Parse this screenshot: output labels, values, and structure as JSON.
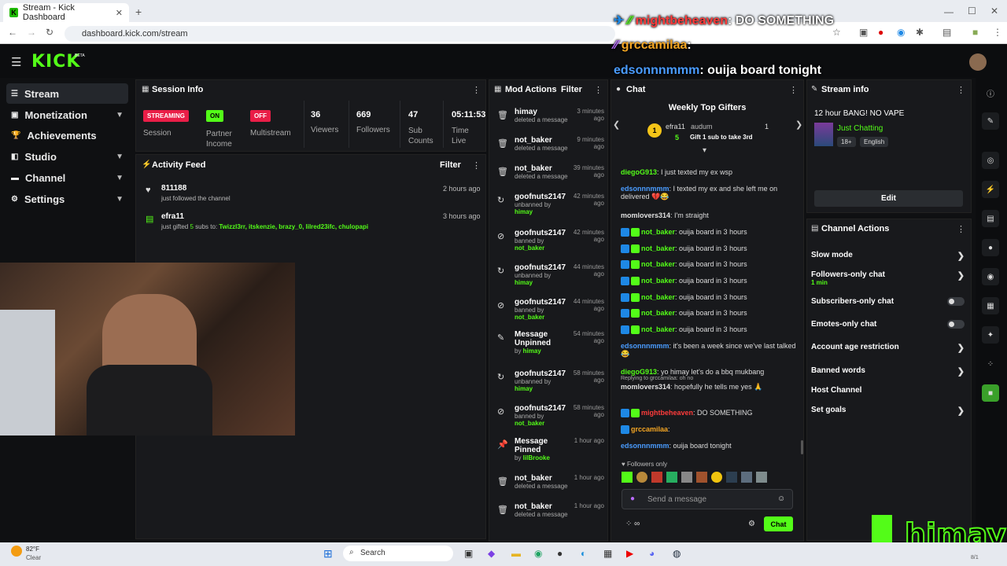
{
  "browser": {
    "tab_title": "Stream - Kick Dashboard",
    "url": "dashboard.kick.com/stream",
    "new_tab": "+"
  },
  "logo": {
    "text": "KICK",
    "beta": "BETA"
  },
  "sidebar": {
    "items": [
      {
        "label": "Stream",
        "icon": "stream-icon"
      },
      {
        "label": "Monetization",
        "icon": "monetization-icon"
      },
      {
        "label": "Achievements",
        "icon": "trophy-icon"
      },
      {
        "label": "Studio",
        "icon": "studio-icon"
      },
      {
        "label": "Channel",
        "icon": "channel-icon"
      },
      {
        "label": "Settings",
        "icon": "gear-icon"
      }
    ]
  },
  "session_info": {
    "title": "Session Info",
    "stats": [
      {
        "badge": "STREAMING",
        "label": "Session"
      },
      {
        "badge": "ON",
        "label": "Partner Income"
      },
      {
        "badge": "OFF",
        "label": "Multistream"
      },
      {
        "value": "36",
        "label": "Viewers"
      },
      {
        "value": "669",
        "label": "Followers"
      },
      {
        "value": "47",
        "label": "Sub Counts"
      },
      {
        "value": "05:11:53",
        "label": "Time Live"
      }
    ]
  },
  "activity_feed": {
    "title": "Activity Feed",
    "filter": "Filter",
    "items": [
      {
        "user": "811188",
        "text": "just followed the channel",
        "time": "2 hours ago"
      },
      {
        "user": "efra11",
        "text_pre": "just gifted ",
        "count": "5",
        "text_mid": " subs to: ",
        "recipients": "Twizzl3rr, itskenzie, brazy_0, lilred23ifc, chulopapi",
        "time": "3 hours ago"
      }
    ]
  },
  "mod_actions": {
    "title": "Mod Actions",
    "filter": "Filter",
    "items": [
      {
        "name": "himay",
        "action": "deleted a message",
        "by": "",
        "time": "3 minutes ago"
      },
      {
        "name": "not_baker",
        "action": "deleted a message",
        "by": "",
        "time": "9 minutes ago"
      },
      {
        "name": "not_baker",
        "action": "deleted a message",
        "by": "",
        "time": "39 minutes ago"
      },
      {
        "name": "goofnuts2147",
        "action": "unbanned by ",
        "by": "himay",
        "time": "42 minutes ago"
      },
      {
        "name": "goofnuts2147",
        "action": "banned by ",
        "by": "not_baker",
        "time": "42 minutes ago"
      },
      {
        "name": "goofnuts2147",
        "action": "unbanned by ",
        "by": "himay",
        "time": "44 minutes ago"
      },
      {
        "name": "goofnuts2147",
        "action": "banned by ",
        "by": "not_baker",
        "time": "44 minutes ago"
      },
      {
        "name": "Message Unpinned",
        "action": "by ",
        "by": "himay",
        "time": "54 minutes ago"
      },
      {
        "name": "goofnuts2147",
        "action": "unbanned by ",
        "by": "himay",
        "time": "58 minutes ago"
      },
      {
        "name": "goofnuts2147",
        "action": "banned by ",
        "by": "not_baker",
        "time": "58 minutes ago"
      },
      {
        "name": "Message Pinned",
        "action": "by ",
        "by": "lilBrooke",
        "time": "1 hour ago"
      },
      {
        "name": "not_baker",
        "action": "deleted a message",
        "by": "",
        "time": "1 hour ago"
      },
      {
        "name": "not_baker",
        "action": "deleted a message",
        "by": "",
        "time": "1 hour ago"
      }
    ]
  },
  "chat": {
    "title": "Chat",
    "top_gifters_title": "Weekly Top Gifters",
    "gifter1": {
      "rank": "1",
      "name": "efra11",
      "count": "5"
    },
    "gifter2": {
      "name": "audum",
      "count": "1",
      "cta": "Gift 1 sub to take 3rd"
    },
    "messages": [
      {
        "user": "diegoG913",
        "color": "#53fc18",
        "text": ": I just texted my ex wsp",
        "badges": 0
      },
      {
        "user": "edsonnnmmm",
        "color": "#4a9cff",
        "text": ": I texted my ex and she left me on delivered 💔😂",
        "badges": 0
      },
      {
        "user": "momlovers314",
        "color": "#e0e0e0",
        "text": ": I'm straight",
        "badges": 0
      },
      {
        "user": "not_baker",
        "color": "#53fc18",
        "text": ": ouija board in 3 hours",
        "badges": 2
      },
      {
        "user": "not_baker",
        "color": "#53fc18",
        "text": ": ouija board in 3 hours",
        "badges": 2
      },
      {
        "user": "not_baker",
        "color": "#53fc18",
        "text": ": ouija board in 3 hours",
        "badges": 2
      },
      {
        "user": "not_baker",
        "color": "#53fc18",
        "text": ": ouija board in 3 hours",
        "badges": 2
      },
      {
        "user": "not_baker",
        "color": "#53fc18",
        "text": ": ouija board in 3 hours",
        "badges": 2
      },
      {
        "user": "not_baker",
        "color": "#53fc18",
        "text": ": ouija board in 3 hours",
        "badges": 2
      },
      {
        "user": "not_baker",
        "color": "#53fc18",
        "text": ": ouija board in 3 hours",
        "badges": 2
      },
      {
        "user": "edsonnnmmm",
        "color": "#4a9cff",
        "text": ": it's been a week since we've last talked😂",
        "badges": 0
      },
      {
        "user": "diegoG913",
        "color": "#53fc18",
        "text": ": yo himay let's do a bbq mukbang",
        "badges": 0
      },
      {
        "reply": "Replying to grccamilaa: oh no",
        "user": "momlovers314",
        "color": "#e0e0e0",
        "text": ": hopefully he tells me yes 🙏",
        "badges": 0
      },
      {
        "user": "mightbeheaven",
        "color": "#ff3b3b",
        "text": ": DO SOMETHING",
        "badges": 2
      },
      {
        "user": "grccamilaa",
        "color": "#f5a623",
        "text": ":",
        "badges": 1
      },
      {
        "user": "edsonnnmmm",
        "color": "#4a9cff",
        "text": ": ouija board tonight",
        "badges": 0
      }
    ],
    "followers_only": "Followers only",
    "placeholder": "Send a message",
    "send": "Chat"
  },
  "stream_info": {
    "title": "Stream info",
    "stream_title": "12 hour BANG! NO VAPE",
    "category": "Just Chatting",
    "tags": [
      "18+",
      "English"
    ],
    "edit": "Edit"
  },
  "channel_actions": {
    "title": "Channel Actions",
    "items": [
      {
        "label": "Slow mode",
        "sub": "",
        "control": "chevron"
      },
      {
        "label": "Followers-only chat",
        "sub": "1 min",
        "control": "chevron"
      },
      {
        "label": "Subscribers-only chat",
        "sub": "",
        "control": "toggle"
      },
      {
        "label": "Emotes-only chat",
        "sub": "",
        "control": "toggle"
      },
      {
        "label": "Account age restriction",
        "sub": "",
        "control": "chevron"
      },
      {
        "label": "Banned words",
        "sub": "",
        "control": "chevron"
      },
      {
        "label": "Host Channel",
        "sub": "",
        "control": "none"
      },
      {
        "label": "Set goals",
        "sub": "",
        "control": "chevron"
      }
    ]
  },
  "overlay": {
    "line1_user": "mightbeheaven",
    "line1_text": ": DO SOMETHING",
    "line2_user": "grccamilaa",
    "line2_text": ":",
    "line3_user": "edsonnnmmm",
    "line3_text": ": ouija board tonight",
    "brand": "himay"
  },
  "taskbar": {
    "weather_temp": "82°F",
    "weather_text": "Clear",
    "search": "Search",
    "date_fragment": "8/1"
  }
}
